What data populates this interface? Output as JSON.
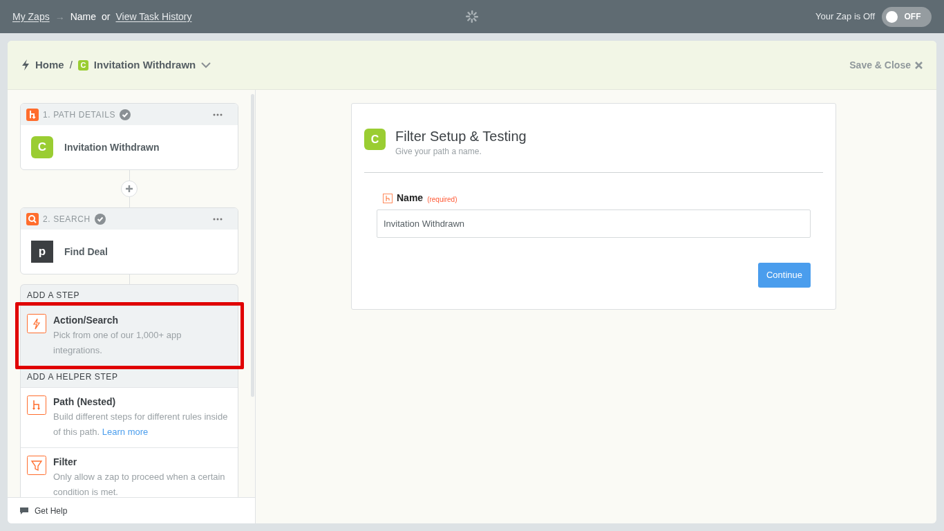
{
  "topbar": {
    "breadcrumb_link": "My Zaps",
    "arrow": "→",
    "current": "Name",
    "separator": "or",
    "history_link": "View Task History",
    "status_label": "Your Zap is Off",
    "toggle": {
      "on": false,
      "text": "OFF"
    }
  },
  "header": {
    "home": "Home",
    "slash": "/",
    "app_letter": "C",
    "zap_name": "Invitation Withdrawn",
    "save_close": "Save & Close"
  },
  "steps": [
    {
      "kind": "path",
      "label": "1. PATH DETAILS",
      "completed": true,
      "app": {
        "kind": "letter",
        "text": "C"
      },
      "title": "Invitation Withdrawn"
    },
    {
      "kind": "search",
      "label": "2. SEARCH",
      "completed": true,
      "app": {
        "kind": "pipedrive",
        "text": "p"
      },
      "title": "Find Deal"
    }
  ],
  "add_sections": [
    {
      "heading": "ADD A STEP",
      "items": [
        {
          "kind": "action",
          "title": "Action/Search",
          "description": "Pick from one of our 1,000+ app integrations.",
          "highlighted": true
        }
      ]
    },
    {
      "heading": "ADD A HELPER STEP",
      "items": [
        {
          "kind": "path",
          "title": "Path (Nested)",
          "description": "Build different steps for different rules inside of this path.",
          "link": "Learn more",
          "highlighted": false
        },
        {
          "kind": "filter",
          "title": "Filter",
          "description": "Only allow a zap to proceed when a certain condition is met.",
          "highlighted": false
        }
      ]
    }
  ],
  "help": "Get Help",
  "panel": {
    "app_letter": "C",
    "title": "Filter Setup & Testing",
    "subtitle": "Give your path a name.",
    "field": {
      "label": "Name",
      "required": "(required)",
      "value": "Invitation Withdrawn"
    },
    "button": "Continue"
  }
}
